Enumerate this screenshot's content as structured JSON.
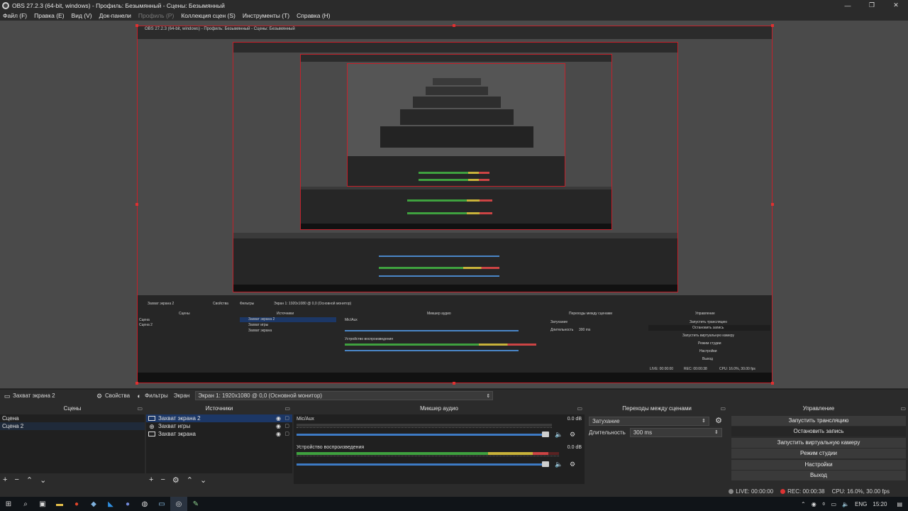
{
  "window": {
    "title": "OBS 27.2.3 (64-bit, windows) - Профиль: Безымянный - Сцены: Безымянный"
  },
  "menu": [
    {
      "label": "Файл (F)",
      "enabled": true
    },
    {
      "label": "Правка (E)",
      "enabled": true
    },
    {
      "label": "Вид (V)",
      "enabled": true
    },
    {
      "label": "Док-панели",
      "enabled": true
    },
    {
      "label": "Профиль (P)",
      "enabled": false
    },
    {
      "label": "Коллекция сцен (S)",
      "enabled": true
    },
    {
      "label": "Инструменты (T)",
      "enabled": true
    },
    {
      "label": "Справка (H)",
      "enabled": true
    }
  ],
  "source_toolbar": {
    "source_name": "Захват экрана 2",
    "properties_label": "Свойства",
    "filters_label": "Фильтры",
    "screen_label": "Экран",
    "screen_value": "Экран 1: 1920x1080 @ 0,0 (Основной монитор)"
  },
  "scenes": {
    "title": "Сцены",
    "items": [
      "Сцена",
      "Сцена 2"
    ]
  },
  "sources": {
    "title": "Источники",
    "items": [
      "Захват экрана 2",
      "Захват игры",
      "Захват экрана"
    ]
  },
  "mixer": {
    "title": "Микшер аудио",
    "channels": [
      {
        "name": "Mic/Aux",
        "db": "0.0 dB",
        "level": 0.0
      },
      {
        "name": "Устройство воспроизведения",
        "db": "0.0 dB",
        "level": 0.96
      }
    ]
  },
  "transitions": {
    "title": "Переходы между сценами",
    "type": "Затухание",
    "duration_label": "Длительность",
    "duration_value": "300 ms"
  },
  "controls": {
    "title": "Управление",
    "buttons": [
      "Запустить трансляцию",
      "Остановить запись",
      "Запустить виртуальную камеру",
      "Режим студии",
      "Настройки",
      "Выход"
    ]
  },
  "status": {
    "live": "LIVE: 00:00:00",
    "rec": "REC: 00:00:38",
    "cpu": "CPU: 16.0%, 30.00 fps"
  },
  "tray": {
    "lang": "ENG",
    "time": "15:20"
  },
  "colors": {
    "accent_red": "#c4202a",
    "selection_blue": "#1c3766",
    "meter_green": "#3fa13f",
    "meter_yellow": "#c8b23a",
    "meter_red": "#cc4444",
    "fader_blue": "#3d7ac4"
  }
}
